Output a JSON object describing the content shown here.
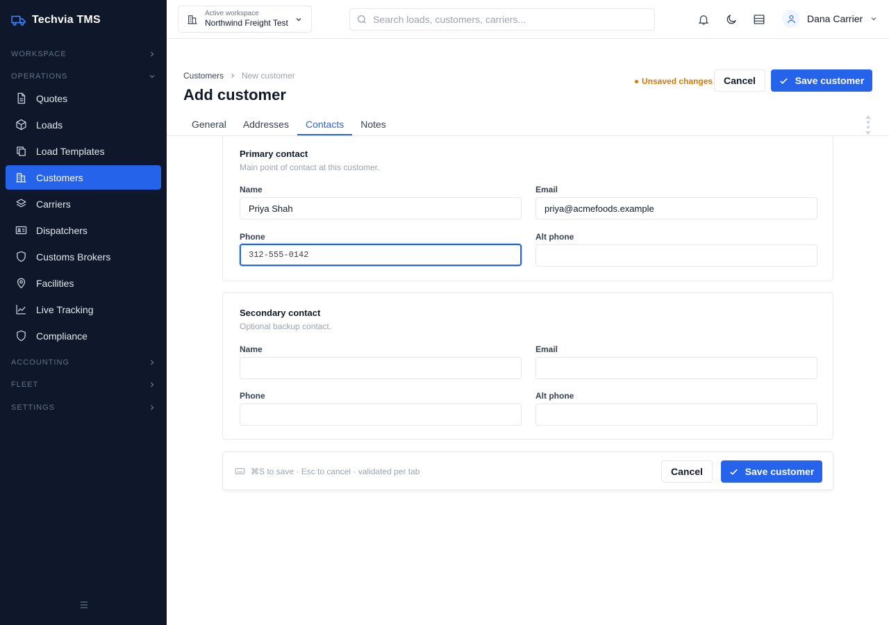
{
  "app": {
    "name": "Techvia TMS"
  },
  "sidebar": {
    "sections": {
      "workspace": "WORKSPACE",
      "operations": "OPERATIONS",
      "accounting": "ACCOUNTING",
      "fleet": "FLEET",
      "settings": "SETTINGS"
    },
    "items": [
      {
        "label": "Quotes",
        "icon": "document-icon"
      },
      {
        "label": "Loads",
        "icon": "box-icon"
      },
      {
        "label": "Load Templates",
        "icon": "copy-icon"
      },
      {
        "label": "Customers",
        "icon": "building-icon",
        "active": true
      },
      {
        "label": "Carriers",
        "icon": "layers-icon"
      },
      {
        "label": "Dispatchers",
        "icon": "id-card-icon"
      },
      {
        "label": "Customs Brokers",
        "icon": "shield-icon"
      },
      {
        "label": "Facilities",
        "icon": "map-pin-icon"
      },
      {
        "label": "Live Tracking",
        "icon": "chart-line-icon"
      },
      {
        "label": "Compliance",
        "icon": "shield-icon"
      }
    ]
  },
  "topbar": {
    "workspace_caption": "Active workspace",
    "workspace_name": "Northwind Freight Test",
    "search_placeholder": "Search loads, customers, carriers...",
    "user_name": "Dana Carrier"
  },
  "page": {
    "breadcrumb": [
      "Customers",
      "New customer"
    ],
    "title": "Add customer",
    "unsaved": "Unsaved changes",
    "cancel_label": "Cancel",
    "save_label": "Save customer"
  },
  "tabs": [
    {
      "label": "General"
    },
    {
      "label": "Addresses"
    },
    {
      "label": "Contacts",
      "active": true
    },
    {
      "label": "Notes"
    }
  ],
  "primary_contact": {
    "title": "Primary contact",
    "subtitle": "Main point of contact at this customer.",
    "name_label": "Name",
    "name_value": "Priya Shah",
    "email_label": "Email",
    "email_value": "priya@acmefoods.example",
    "phone_label": "Phone",
    "phone_value": "312-555-0142",
    "alt_phone_label": "Alt phone",
    "alt_phone_value": ""
  },
  "secondary_contact": {
    "title": "Secondary contact",
    "subtitle": "Optional backup contact.",
    "name_label": "Name",
    "name_value": "",
    "email_label": "Email",
    "email_value": "",
    "phone_label": "Phone",
    "phone_value": "",
    "alt_phone_label": "Alt phone",
    "alt_phone_value": ""
  },
  "footer": {
    "hint": "⌘S to save · Esc to cancel · validated per tab",
    "cancel_label": "Cancel",
    "save_label": "Save customer"
  },
  "colors": {
    "sidebar_bg": "#0f172a",
    "accent": "#2563eb",
    "warning": "#d97706"
  }
}
